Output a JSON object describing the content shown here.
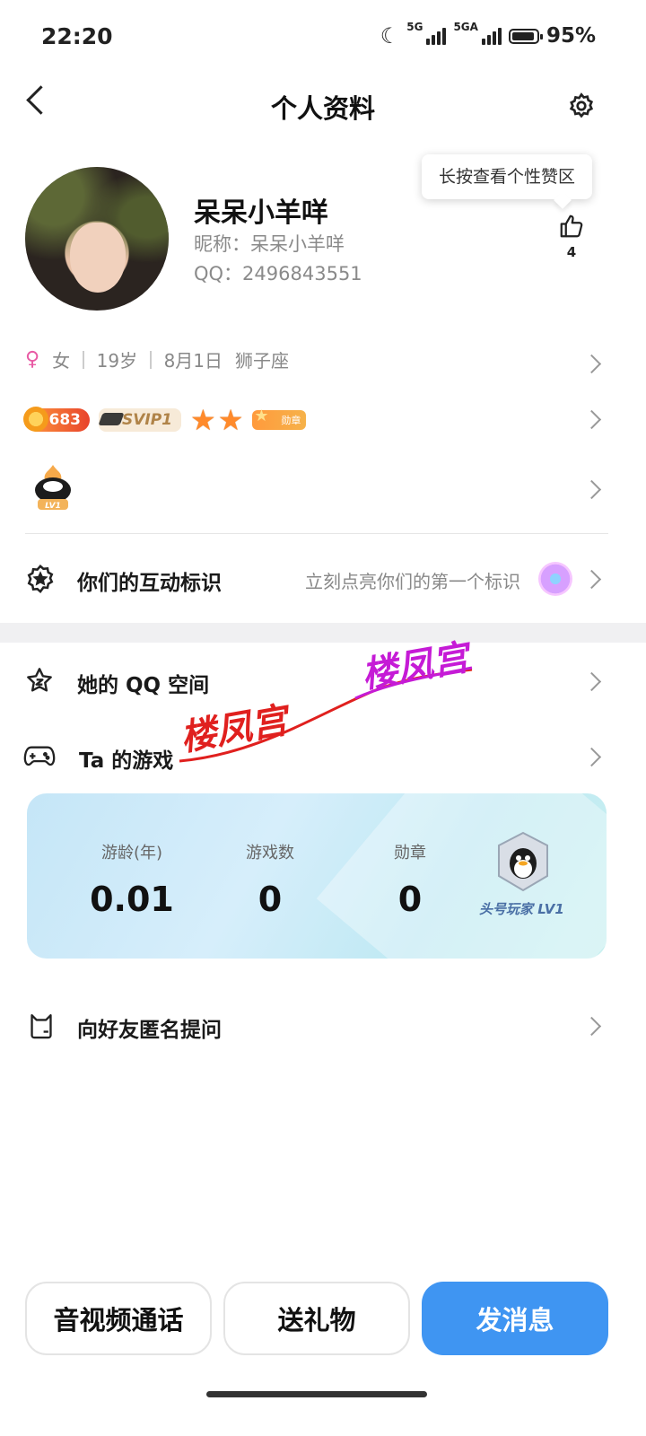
{
  "status_bar": {
    "time": "22:20",
    "net1": "5G",
    "net2": "5GA",
    "battery": "95%"
  },
  "header": {
    "title": "个人资料"
  },
  "profile": {
    "name": "呆呆小羊咩",
    "nickname": "昵称：呆呆小羊咩",
    "qq": "QQ：2496843551",
    "tooltip": "长按查看个性赞区",
    "likes": "4"
  },
  "info": {
    "gender": "女",
    "age": "19岁",
    "birthday": "8月1日",
    "zodiac": "狮子座"
  },
  "badges": {
    "points": "683",
    "svip": "SVIP1",
    "medal": "勋章"
  },
  "level": {
    "label": "LV1"
  },
  "interaction": {
    "label": "你们的互动标识",
    "hint": "立刻点亮你们的第一个标识"
  },
  "qzone": {
    "label": "她的 QQ 空间"
  },
  "games": {
    "label": "Ta 的游戏",
    "stats": [
      {
        "label": "游龄(年)",
        "value": "0.01"
      },
      {
        "label": "游戏数",
        "value": "0"
      },
      {
        "label": "勋章",
        "value": "0"
      }
    ],
    "player_tag": "头号玩家 LV1"
  },
  "anonymous": {
    "label": "向好友匿名提问"
  },
  "watermark": {
    "text1": "楼凤宫",
    "text2": "楼凤宫"
  },
  "buttons": {
    "call": "音视频通话",
    "gift": "送礼物",
    "message": "发消息"
  }
}
